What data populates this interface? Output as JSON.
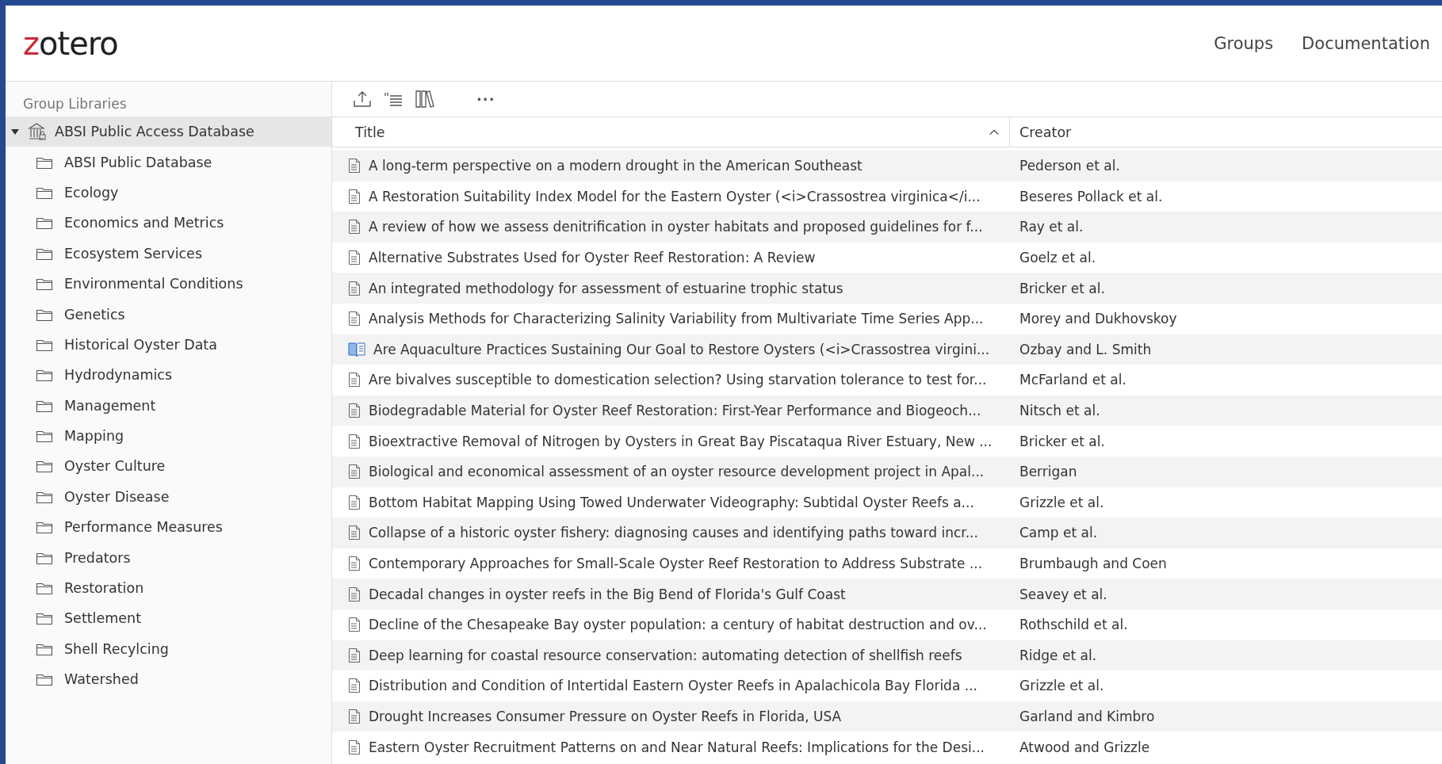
{
  "header": {
    "logo": {
      "accent": "z",
      "rest": "otero"
    },
    "nav": [
      "Groups",
      "Documentation"
    ]
  },
  "sidebar": {
    "heading": "Group Libraries",
    "library": {
      "label": "ABSI Public Access Database",
      "expanded": true,
      "selected": true,
      "children": [
        {
          "label": "ABSI Public Database",
          "selected": false
        },
        {
          "label": "Ecology",
          "selected": false
        },
        {
          "label": "Economics and Metrics",
          "selected": false
        },
        {
          "label": "Ecosystem Services",
          "selected": false
        },
        {
          "label": "Environmental Conditions",
          "selected": false
        },
        {
          "label": "Genetics",
          "selected": false
        },
        {
          "label": "Historical Oyster Data",
          "selected": false
        },
        {
          "label": "Hydrodynamics",
          "selected": false
        },
        {
          "label": "Management",
          "selected": false
        },
        {
          "label": "Mapping",
          "selected": false
        },
        {
          "label": "Oyster Culture",
          "selected": false
        },
        {
          "label": "Oyster Disease",
          "selected": false
        },
        {
          "label": "Performance Measures",
          "selected": false
        },
        {
          "label": "Predators",
          "selected": false
        },
        {
          "label": "Restoration",
          "selected": false
        },
        {
          "label": "Settlement",
          "selected": false
        },
        {
          "label": "Shell Recylcing",
          "selected": false
        },
        {
          "label": "Watershed",
          "selected": false
        }
      ]
    }
  },
  "toolbar": {
    "more": "···"
  },
  "table": {
    "columns": [
      {
        "label": "Title",
        "sorted": true
      },
      {
        "label": "Creator",
        "sorted": false
      }
    ],
    "rows": [
      {
        "kind": "document",
        "title": "A long-term perspective on a modern drought in the American Southeast",
        "creator": "Pederson et al."
      },
      {
        "kind": "document",
        "title": "A Restoration Suitability Index Model for the Eastern Oyster (<i>Crassostrea virginica</i...",
        "creator": "Beseres Pollack et al."
      },
      {
        "kind": "document",
        "title": "A review of how we assess denitrification in oyster habitats and proposed guidelines for f...",
        "creator": "Ray et al."
      },
      {
        "kind": "document",
        "title": "Alternative Substrates Used for Oyster Reef Restoration: A Review",
        "creator": "Goelz et al."
      },
      {
        "kind": "document",
        "title": "An integrated methodology for assessment of estuarine trophic status",
        "creator": "Bricker et al."
      },
      {
        "kind": "document",
        "title": "Analysis Methods for Characterizing Salinity Variability from Multivariate Time Series App...",
        "creator": "Morey and Dukhovskoy"
      },
      {
        "kind": "book",
        "title": "Are Aquaculture Practices Sustaining Our Goal to Restore Oysters (<i>Crassostrea virgini...",
        "creator": "Ozbay and L. Smith"
      },
      {
        "kind": "document",
        "title": "Are bivalves susceptible to domestication selection? Using starvation tolerance to test for...",
        "creator": "McFarland et al."
      },
      {
        "kind": "document",
        "title": "Biodegradable Material for Oyster Reef Restoration: First-Year Performance and Biogeoch...",
        "creator": "Nitsch et al."
      },
      {
        "kind": "document",
        "title": "Bioextractive Removal of Nitrogen by Oysters in Great Bay Piscataqua River Estuary, New ...",
        "creator": "Bricker et al."
      },
      {
        "kind": "document",
        "title": "Biological and economical assessment of an oyster resource development project in Apal...",
        "creator": "Berrigan"
      },
      {
        "kind": "document",
        "title": "Bottom Habitat Mapping Using Towed Underwater Videography: Subtidal Oyster Reefs a...",
        "creator": "Grizzle et al."
      },
      {
        "kind": "document",
        "title": "Collapse of a historic oyster fishery: diagnosing causes and identifying paths toward incr...",
        "creator": "Camp et al."
      },
      {
        "kind": "document",
        "title": "Contemporary Approaches for Small-Scale Oyster Reef Restoration to Address Substrate ...",
        "creator": "Brumbaugh and Coen"
      },
      {
        "kind": "document",
        "title": "Decadal changes in oyster reefs in the Big Bend of Florida's Gulf Coast",
        "creator": "Seavey et al."
      },
      {
        "kind": "document",
        "title": "Decline of the Chesapeake Bay oyster population: a century of habitat destruction and ov...",
        "creator": "Rothschild et al."
      },
      {
        "kind": "document",
        "title": "Deep learning for coastal resource conservation: automating detection of shellfish reefs",
        "creator": "Ridge et al."
      },
      {
        "kind": "document",
        "title": "Distribution and Condition of Intertidal Eastern Oyster Reefs in Apalachicola Bay Florida ...",
        "creator": "Grizzle et al."
      },
      {
        "kind": "document",
        "title": "Drought Increases Consumer Pressure on Oyster Reefs in Florida, USA",
        "creator": "Garland and Kimbro"
      },
      {
        "kind": "document",
        "title": "Eastern Oyster Recruitment Patterns on and Near Natural Reefs: Implications for the Desi...",
        "creator": "Atwood and Grizzle"
      }
    ]
  }
}
